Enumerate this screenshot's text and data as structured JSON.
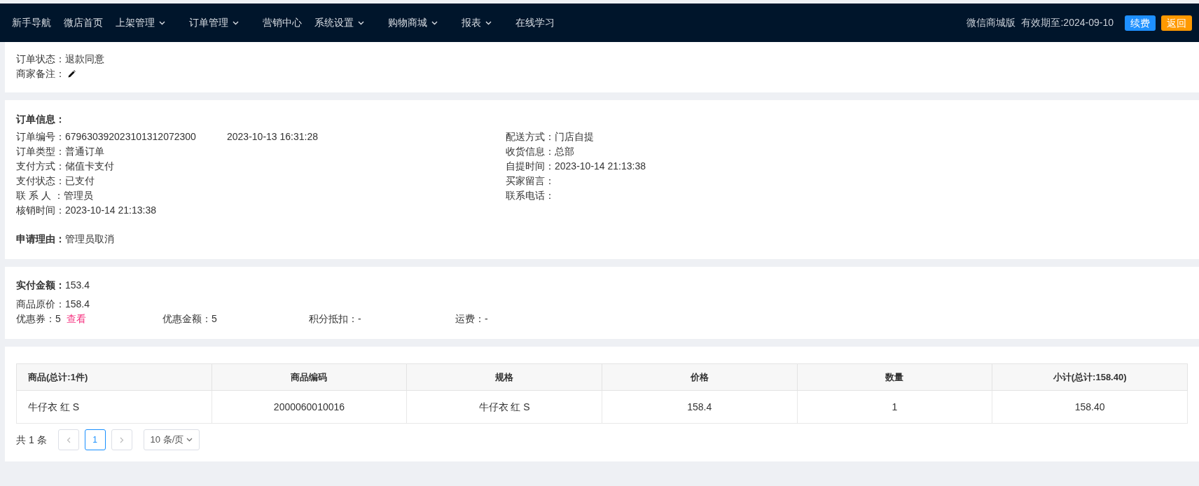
{
  "nav": {
    "items": [
      {
        "label": "新手导航",
        "dropdown": false
      },
      {
        "label": "微店首页",
        "dropdown": false
      },
      {
        "label": "上架管理",
        "dropdown": true
      },
      {
        "label": "订单管理",
        "dropdown": true
      },
      {
        "label": "营销中心",
        "dropdown": false
      },
      {
        "label": "系统设置",
        "dropdown": true
      },
      {
        "label": "购物商城",
        "dropdown": true
      },
      {
        "label": "报表",
        "dropdown": true
      },
      {
        "label": "在线学习",
        "dropdown": false
      }
    ],
    "edition": "微信商城版",
    "expiry": "有效期至:2024-09-10",
    "buttons": [
      {
        "label": "续费",
        "kind": "renew"
      },
      {
        "label": "返回",
        "kind": "back"
      }
    ]
  },
  "status": {
    "order_status": {
      "label": "订单状态：",
      "value": "退款同意"
    },
    "remark": {
      "label": "商家备注："
    }
  },
  "order_info": {
    "title": "订单信息：",
    "left": [
      {
        "label": "订单编号：",
        "value": "679630392023101312072300",
        "extra": "2023-10-13 16:31:28"
      },
      {
        "label": "订单类型：",
        "value": "普通订单"
      },
      {
        "label": "支付方式：",
        "value": "储值卡支付"
      },
      {
        "label": "支付状态：",
        "value": "已支付"
      },
      {
        "label": "联 系 人 ：",
        "value": "管理员"
      },
      {
        "label": "核销时间：",
        "value": "2023-10-14 21:13:38"
      }
    ],
    "right": [
      {
        "label": "配送方式：",
        "value": "门店自提"
      },
      {
        "label": "收货信息：",
        "value": "总部"
      },
      {
        "label": "自提时间：",
        "value": "2023-10-14 21:13:38"
      },
      {
        "label": "买家留言："
      },
      {
        "label": "联系电话："
      }
    ],
    "reason": {
      "label": "申请理由：",
      "value": "管理员取消"
    }
  },
  "amounts": {
    "paid": {
      "label": "实付金额：",
      "value": "153.4"
    },
    "original": {
      "label": "商品原价：",
      "value": "158.4"
    },
    "items": [
      {
        "label": "优惠券：",
        "value": "5",
        "link": "查看"
      },
      {
        "label": "优惠金额：",
        "value": "5"
      },
      {
        "label": "积分抵扣：",
        "value": "-"
      },
      {
        "label": "运费：",
        "value": "-"
      }
    ]
  },
  "table": {
    "columns": [
      "商品(总计:1件)",
      "商品编码",
      "规格",
      "价格",
      "数量",
      "小计(总计:158.40)"
    ],
    "rows": [
      [
        "牛仔衣 红 S",
        "2000060010016",
        "牛仔衣 红 S",
        "158.4",
        "1",
        "158.40"
      ]
    ]
  },
  "pagination": {
    "total": "共 1 条",
    "pages": [
      {
        "label": "1",
        "selected": true
      }
    ],
    "page_size": "10 条/页"
  }
}
